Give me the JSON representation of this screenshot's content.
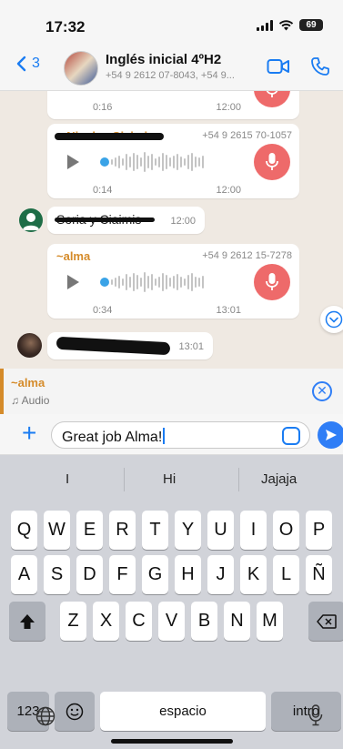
{
  "status_bar": {
    "time": "17:32",
    "battery": "69"
  },
  "header": {
    "back_count": "3",
    "title": "Inglés inicial 4ºH2",
    "subtitle": "+54 9 2612 07-8043, +54 9..."
  },
  "messages": {
    "voice_1": {
      "duration": "0:16",
      "time": "12:00"
    },
    "voice_2": {
      "sender": "~ Nicolas Ciaimis",
      "phone": "+54 9 2615 70-1057",
      "duration": "0:14",
      "time": "12:00"
    },
    "text_1": {
      "text": "Soria y Ciaimis",
      "time": "12:00"
    },
    "voice_3": {
      "sender": "~alma",
      "phone": "+54 9 2612 15-7278",
      "duration": "0:34",
      "time": "13:01"
    },
    "text_2": {
      "time": "13:01"
    }
  },
  "reply_preview": {
    "name": "~alma",
    "type": "Audio"
  },
  "composer": {
    "text": "Great job Alma!"
  },
  "keyboard": {
    "suggestions": [
      "I",
      "Hi",
      "Jajaja"
    ],
    "row1": [
      "Q",
      "W",
      "E",
      "R",
      "T",
      "Y",
      "U",
      "I",
      "O",
      "P"
    ],
    "row2": [
      "A",
      "S",
      "D",
      "F",
      "G",
      "H",
      "J",
      "K",
      "L",
      "Ñ"
    ],
    "row3": [
      "Z",
      "X",
      "C",
      "V",
      "B",
      "N",
      "M"
    ],
    "numbers_label": "123",
    "space_label": "espacio",
    "return_label": "intro"
  },
  "colors": {
    "accent": "#1a7cf2",
    "sender_orange": "#d58b2a",
    "mic_red": "#ee6a6a",
    "chat_bg": "#efe9e2"
  }
}
